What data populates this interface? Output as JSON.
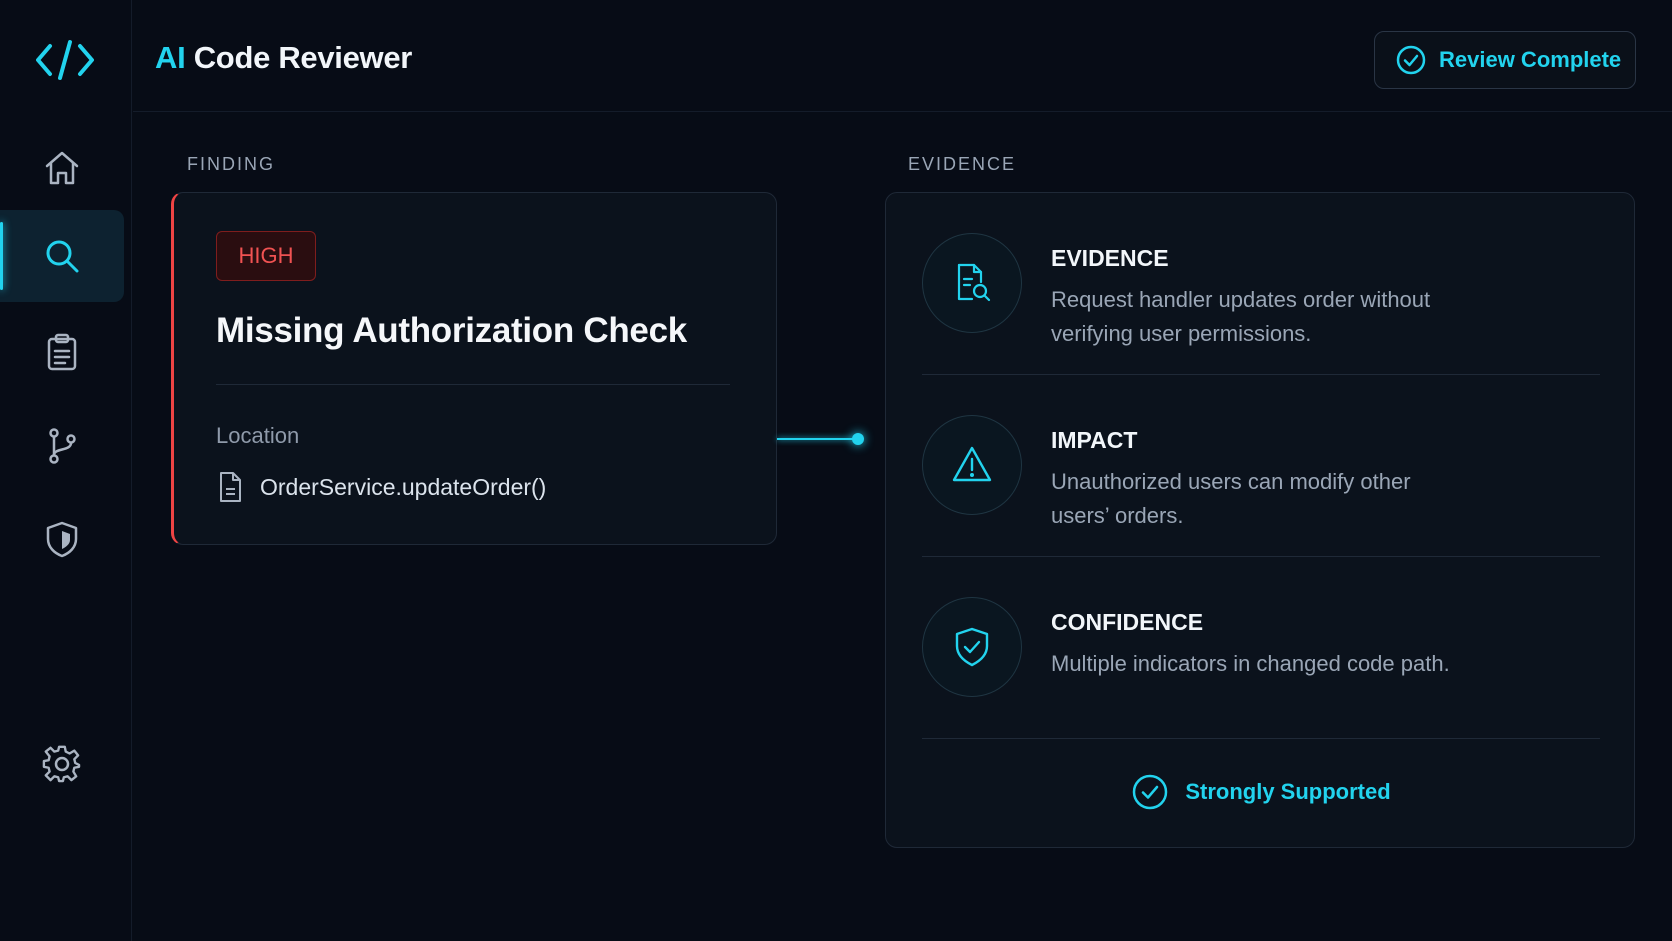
{
  "app": {
    "title_prefix": "AI",
    "title_rest": " Code Reviewer"
  },
  "header": {
    "status_button_label": "Review Complete"
  },
  "sidebar": {
    "items": [
      {
        "icon": "home-icon",
        "active": false
      },
      {
        "icon": "search-icon",
        "active": true
      },
      {
        "icon": "clipboard-icon",
        "active": false
      },
      {
        "icon": "git-branch-icon",
        "active": false
      },
      {
        "icon": "shield-icon",
        "active": false
      },
      {
        "icon": "gear-icon",
        "active": false
      }
    ]
  },
  "finding": {
    "section_label": "FINDING",
    "severity": "HIGH",
    "title": "Missing Authorization Check",
    "location_label": "Location",
    "location_value": "OrderService.updateOrder()"
  },
  "evidence": {
    "section_label": "EVIDENCE",
    "items": [
      {
        "icon": "document-search-icon",
        "heading": "EVIDENCE",
        "text": "Request handler updates order without verifying user permissions."
      },
      {
        "icon": "warning-icon",
        "heading": "IMPACT",
        "text": "Unauthorized users can modify other users’ orders."
      },
      {
        "icon": "shield-check-icon",
        "heading": "CONFIDENCE",
        "text": "Multiple indicators in changed code path."
      }
    ],
    "verdict": "Strongly Supported"
  },
  "colors": {
    "accent": "#22d3ee",
    "danger": "#ef4444",
    "background": "#070c16",
    "card": "#0b121c"
  }
}
